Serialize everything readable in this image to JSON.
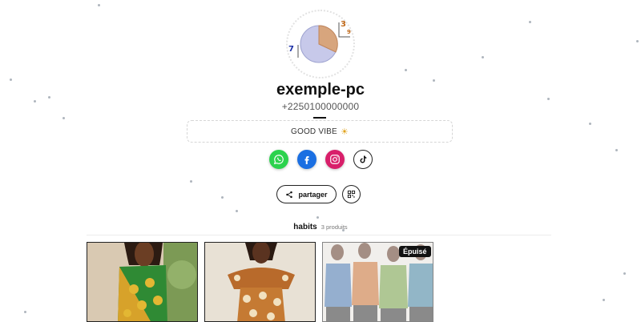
{
  "profile": {
    "avatar_label_top": "3",
    "avatar_label_top_small": "9",
    "avatar_label_left": "7",
    "name": "exemple-pc",
    "phone": "+2250100000000",
    "bio_text": "GOOD VIBE",
    "bio_emoji": "☀"
  },
  "socials": [
    {
      "name": "whatsapp",
      "icon": "whatsapp-icon",
      "color": "#2bd24d"
    },
    {
      "name": "facebook",
      "icon": "facebook-icon",
      "color": "#1b6fe2"
    },
    {
      "name": "instagram",
      "icon": "instagram-icon",
      "color": "#d81f6a"
    },
    {
      "name": "tiktok",
      "icon": "tiktok-icon",
      "color": "#000000"
    }
  ],
  "actions": {
    "share_label": "partager",
    "qr_icon": "qr-code-icon"
  },
  "collection": {
    "name": "habits",
    "count_label": "3 produits",
    "products": [
      {
        "status": ""
      },
      {
        "status": ""
      },
      {
        "status": "Épuisé"
      }
    ]
  }
}
